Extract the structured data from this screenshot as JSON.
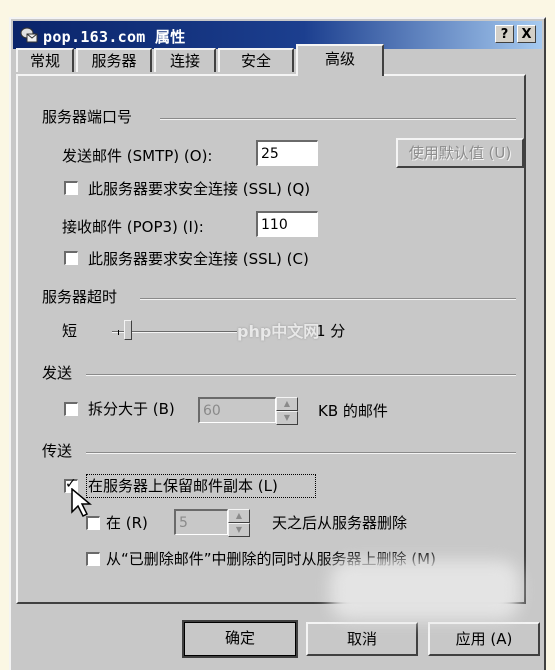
{
  "window": {
    "title": "pop.163.com 属性",
    "help_label": "?",
    "close_label": "X"
  },
  "tabs": [
    {
      "label": "常规"
    },
    {
      "label": "服务器"
    },
    {
      "label": "连接"
    },
    {
      "label": "安全"
    },
    {
      "label": "高级"
    }
  ],
  "ports": {
    "group_title": "服务器端口号",
    "smtp_label": "发送邮件 (SMTP) (O):",
    "smtp_value": "25",
    "use_default_label": "使用默认值 (U)",
    "smtp_ssl_label": "此服务器要求安全连接 (SSL) (Q)",
    "pop3_label": "接收邮件 (POP3) (I):",
    "pop3_value": "110",
    "pop3_ssl_label": "此服务器要求安全连接 (SSL) (C)"
  },
  "timeout": {
    "group_title": "服务器超时",
    "short_label": "短",
    "value_label": "1 分",
    "slider_fraction": 0.1
  },
  "send": {
    "group_title": "发送",
    "split_label": "拆分大于 (B)",
    "split_value": "60",
    "unit_label": "KB 的邮件"
  },
  "delivery": {
    "group_title": "传送",
    "keep_copy_label": "在服务器上保留邮件副本 (L)",
    "keep_copy_checked": true,
    "remove_after_label": "在 (R)",
    "remove_after_value": "5",
    "days_label": "天之后从服务器删除",
    "remove_deleted_label": "从“已删除邮件”中删除的同时从服务器上删除 (M)"
  },
  "buttons": {
    "ok": "确定",
    "cancel": "取消",
    "apply": "应用 (A)"
  },
  "watermark": "php中文网"
}
